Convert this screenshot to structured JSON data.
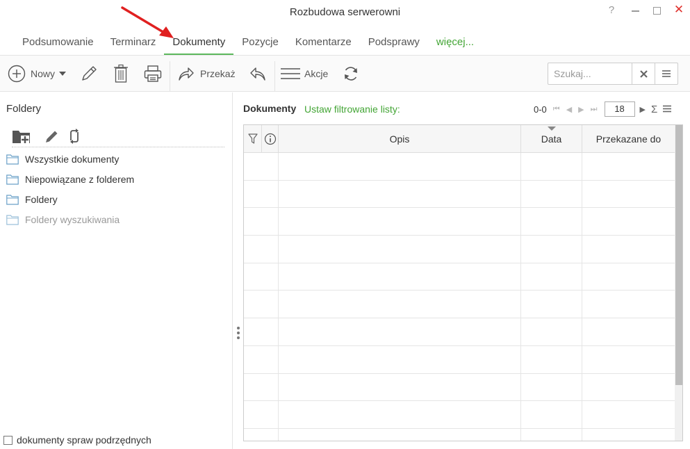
{
  "window": {
    "title": "Rozbudowa serwerowni",
    "help": "?",
    "close": "✕"
  },
  "tabs": [
    {
      "label": "Podsumowanie",
      "active": false
    },
    {
      "label": "Terminarz",
      "active": false
    },
    {
      "label": "Dokumenty",
      "active": true
    },
    {
      "label": "Pozycje",
      "active": false
    },
    {
      "label": "Komentarze",
      "active": false
    },
    {
      "label": "Podsprawy",
      "active": false
    },
    {
      "label": "więcej...",
      "active": false
    }
  ],
  "toolbar": {
    "new_label": "Nowy",
    "forward_label": "Przekaż",
    "actions_label": "Akcje",
    "icons": [
      "plus-circle-icon",
      "caret-down-icon",
      "pencil-icon",
      "trash-icon",
      "printer-icon",
      "forward-icon",
      "reply-icon",
      "hamburger-icon",
      "refresh-icon"
    ]
  },
  "search": {
    "placeholder": "Szukaj...",
    "value": ""
  },
  "left_panel": {
    "title": "Foldery",
    "folders": [
      {
        "label": "Wszystkie dokumenty",
        "dim": false
      },
      {
        "label": "Niepowiązane z folderem",
        "dim": false
      },
      {
        "label": "Foldery",
        "dim": false
      },
      {
        "label": "Foldery wyszukiwania",
        "dim": true
      }
    ],
    "subcases_checkbox": {
      "label": "dokumenty spraw podrzędnych",
      "checked": false
    }
  },
  "documents": {
    "title": "Dokumenty",
    "filter_link": "Ustaw filtrowanie listy:",
    "range": "0-0",
    "page_size": "18",
    "sigma": "Σ",
    "columns": [
      "",
      "",
      "Opis",
      "Data",
      "Przekazane do"
    ],
    "sorted_column": "Data",
    "row_count": 0
  },
  "colors": {
    "accent_green": "#43a535",
    "tab_underline": "#5cb85c",
    "close_red": "#e0312d",
    "annotation_arrow": "#e02020"
  }
}
